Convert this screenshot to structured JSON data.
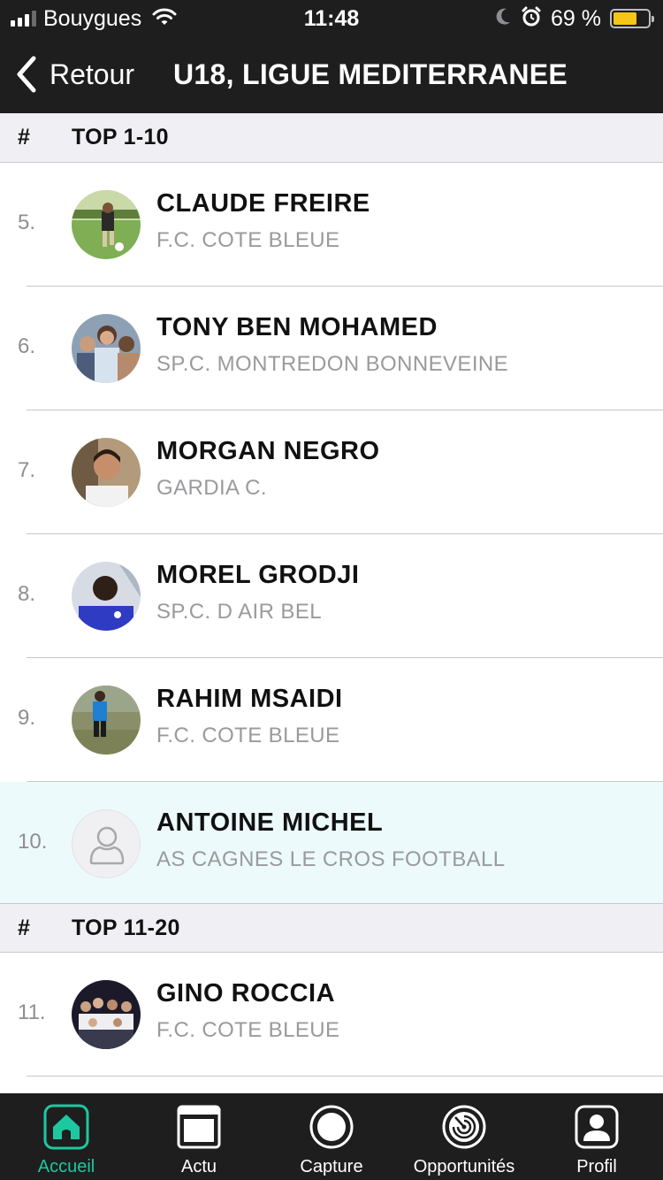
{
  "status_bar": {
    "carrier": "Bouygues",
    "time": "11:48",
    "battery_percent": "69 %",
    "battery_level": 0.69,
    "icons": [
      "signal-icon",
      "wifi-icon",
      "moon-icon",
      "alarm-icon",
      "battery-icon"
    ]
  },
  "nav": {
    "back_label": "Retour",
    "title": "U18, LIGUE MEDITERRANEE"
  },
  "sections": [
    {
      "hash": "#",
      "title": "TOP 1-10"
    },
    {
      "hash": "#",
      "title": "TOP 11-20"
    }
  ],
  "rows": [
    {
      "rank": "5.",
      "name": "CLAUDE FREIRE",
      "club": "F.C. COTE BLEUE"
    },
    {
      "rank": "6.",
      "name": "TONY BEN MOHAMED",
      "club": "SP.C. MONTREDON BONNEVEINE"
    },
    {
      "rank": "7.",
      "name": "MORGAN NEGRO",
      "club": "GARDIA C."
    },
    {
      "rank": "8.",
      "name": "MOREL GRODJI",
      "club": "SP.C. D AIR BEL"
    },
    {
      "rank": "9.",
      "name": "RAHIM MSAIDI",
      "club": "F.C. COTE BLEUE"
    },
    {
      "rank": "10.",
      "name": "ANTOINE MICHEL",
      "club": "AS CAGNES LE CROS FOOTBALL"
    },
    {
      "rank": "11.",
      "name": "GINO ROCCIA",
      "club": "F.C. COTE BLEUE"
    }
  ],
  "tabs": [
    {
      "label": "Accueil",
      "icon": "home-icon",
      "active": true
    },
    {
      "label": "Actu",
      "icon": "news-icon",
      "active": false
    },
    {
      "label": "Capture",
      "icon": "capture-icon",
      "active": false
    },
    {
      "label": "Opportunités",
      "icon": "opportunities-icon",
      "active": false
    },
    {
      "label": "Profil",
      "icon": "profile-icon",
      "active": false
    }
  ],
  "colors": {
    "bar_background": "#1e1e1e",
    "accent": "#1dc8a0",
    "highlight_row": "#edfafb",
    "section_background": "#efeff4",
    "battery": "#f5c518"
  }
}
